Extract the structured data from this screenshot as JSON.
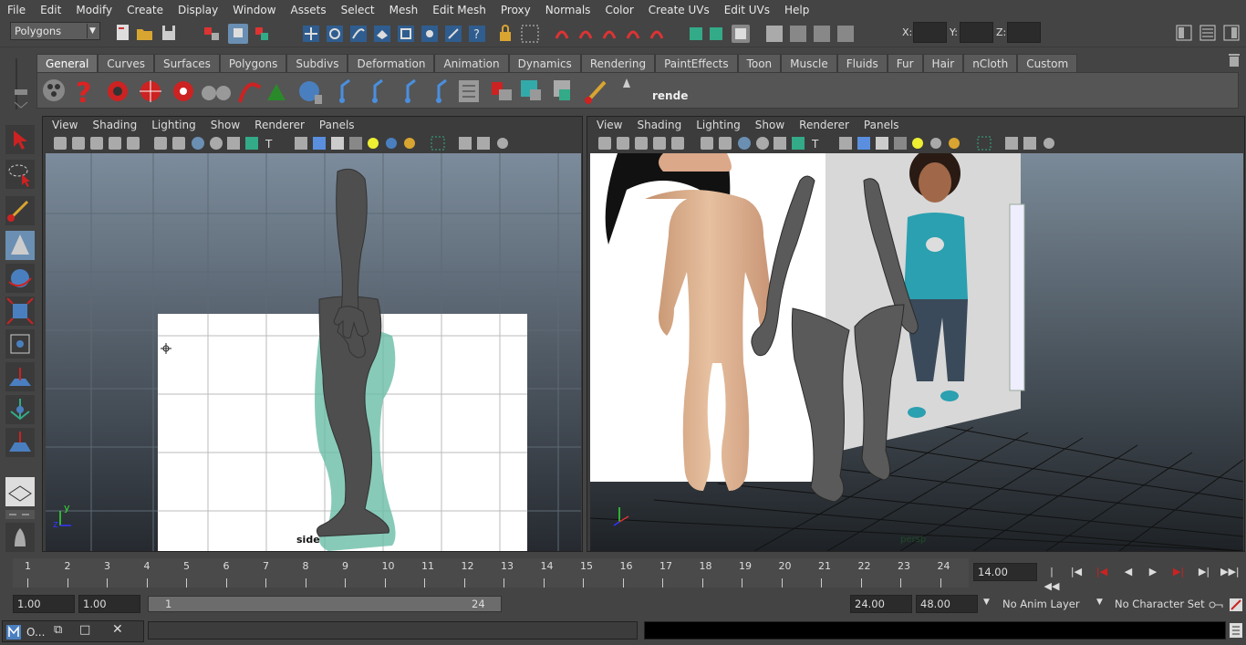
{
  "menu": [
    "File",
    "Edit",
    "Modify",
    "Create",
    "Display",
    "Window",
    "Assets",
    "Select",
    "Mesh",
    "Edit Mesh",
    "Proxy",
    "Normals",
    "Color",
    "Create UVs",
    "Edit UVs",
    "Help"
  ],
  "status_line": {
    "mode": "Polygons",
    "x_label": "X:",
    "y_label": "Y:",
    "z_label": "Z:"
  },
  "shelf": {
    "tabs": [
      "General",
      "Curves",
      "Surfaces",
      "Polygons",
      "Subdivs",
      "Deformation",
      "Animation",
      "Dynamics",
      "Rendering",
      "PaintEffects",
      "Toon",
      "Muscle",
      "Fluids",
      "Fur",
      "Hair",
      "nCloth",
      "Custom"
    ],
    "active_tab": "General",
    "last_icon_label": "rende"
  },
  "left_panel": {
    "menu": [
      "View",
      "Shading",
      "Lighting",
      "Show",
      "Renderer",
      "Panels"
    ],
    "camera_label": "side",
    "axis_y": "y",
    "axis_z": "z"
  },
  "right_panel": {
    "menu": [
      "View",
      "Shading",
      "Lighting",
      "Show",
      "Renderer",
      "Panels"
    ],
    "camera_label": "persp"
  },
  "time_slider": {
    "ticks": [
      "1",
      "2",
      "3",
      "4",
      "5",
      "6",
      "7",
      "8",
      "9",
      "10",
      "11",
      "12",
      "13",
      "14",
      "15",
      "16",
      "17",
      "18",
      "19",
      "20",
      "21",
      "22",
      "23",
      "24"
    ],
    "current_time": "14.00"
  },
  "range_slider": {
    "start_time": "1.00",
    "range_start": "1.00",
    "bar_start": "1",
    "bar_end": "24",
    "range_end": "24.00",
    "end_time": "48.00",
    "anim_layer": "No Anim Layer",
    "char_set": "No Character Set"
  },
  "minimized_window": {
    "title": "O..."
  },
  "colors": {
    "bg": "#444444",
    "viewport_top": "#7a8a9a",
    "viewport_bottom": "#1e2226",
    "accent": "#5a9a8a"
  }
}
